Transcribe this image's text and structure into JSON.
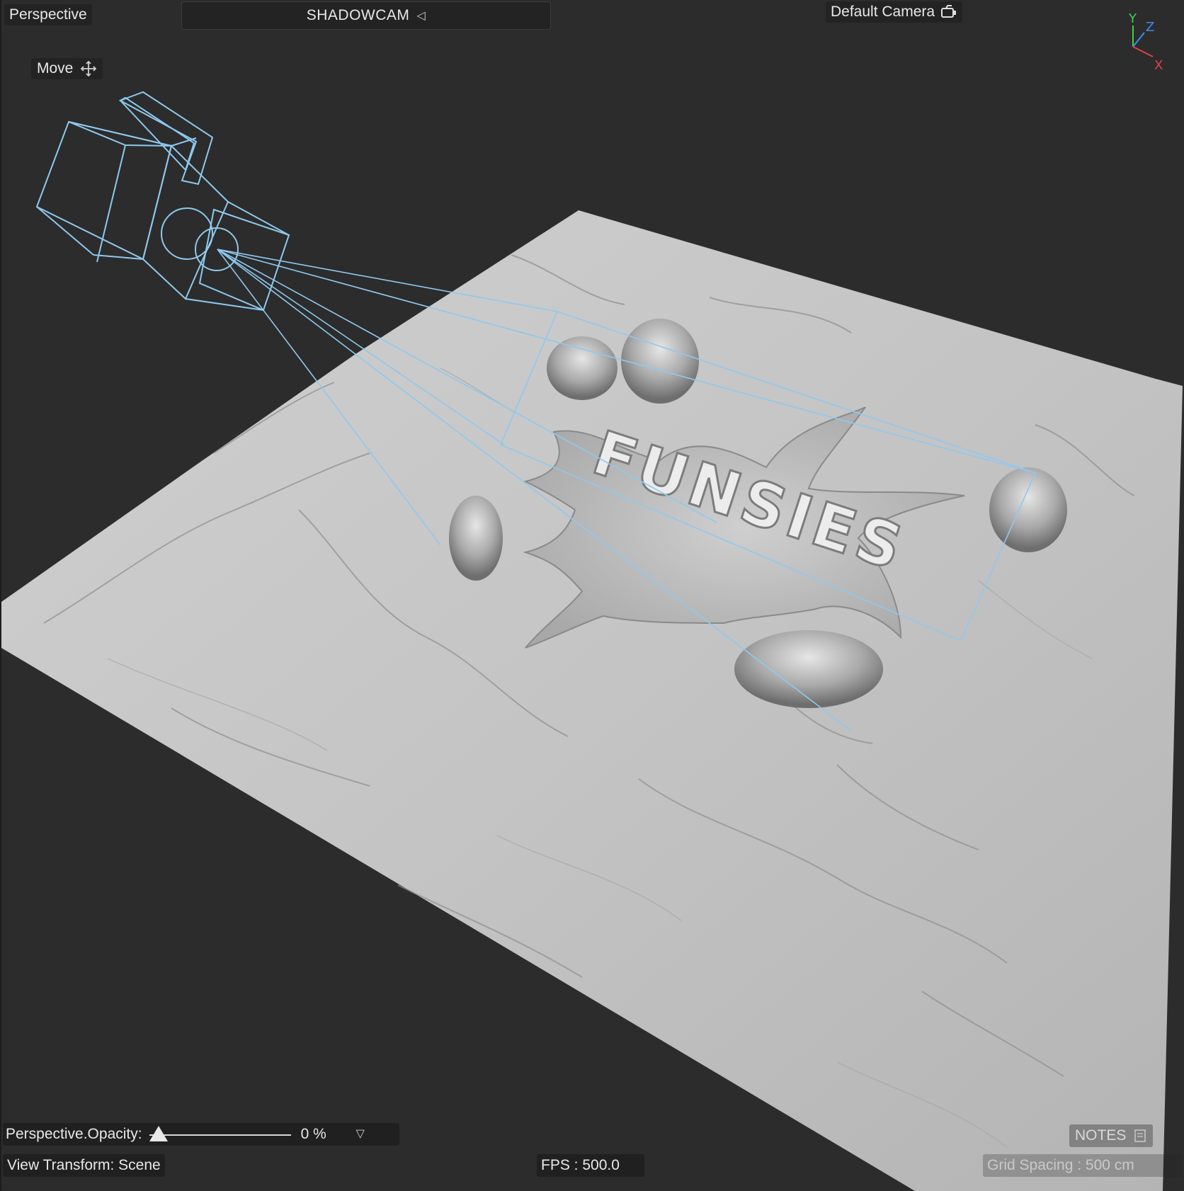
{
  "viewport": {
    "view_label": "Perspective",
    "camera_name": "SHADOWCAM",
    "camera_selector": "Default Camera",
    "active_tool": "Move",
    "model_text": "FUNSIES"
  },
  "axis_gizmo": {
    "y": "Y",
    "z": "Z",
    "x": "X"
  },
  "footer": {
    "opacity_label": "Perspective.Opacity:",
    "opacity_value": "0 %",
    "opacity_level": 0,
    "view_transform": "View Transform: Scene",
    "fps": "FPS : 500.0",
    "notes": "NOTES",
    "grid_spacing": "Grid Spacing : 500 cm"
  },
  "colors": {
    "background": "#2c2c2c",
    "terrain": "#c8c8c8",
    "camera_wireframe": "#8ec9ee",
    "axis_x": "#e0404a",
    "axis_y": "#3fcf5a",
    "axis_z": "#3a8ef0"
  },
  "icons": [
    "move-icon",
    "camera-switch-icon",
    "dropdown-arrow-icon",
    "notes-icon",
    "collapse-triangle-icon"
  ]
}
